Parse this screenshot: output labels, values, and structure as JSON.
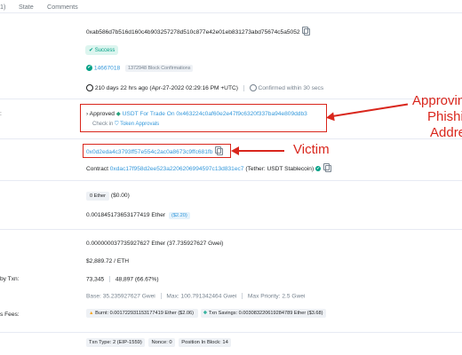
{
  "tabs": {
    "first": "1)",
    "state": "State",
    "comments": "Comments"
  },
  "tx": {
    "hash": "0xab586d7b516d160c4b903257278d510c877e42e01eb831273abd75674c5a5052",
    "status": "Success",
    "block": "14667018",
    "confirmations": "1372948 Block Confirmations",
    "timestamp": "210 days 22 hrs ago (Apr-27-2022 02:29:16 PM +UTC)",
    "confirmed": "Confirmed within 30 secs"
  },
  "action": {
    "row_label": ":",
    "arrow": "›",
    "approved_word": "Approved",
    "token_text": "USDT For Trade On",
    "spender": "0x463224c0af60e2e47f9c6320f337ba94e809ddb3",
    "check_prefix": "Check in",
    "token_approvals": "Token Approvals"
  },
  "from": {
    "address": "0x0d2eda4c3793ff57e554c2ac0a8673c9ffc681fb"
  },
  "to": {
    "prefix": "Contract",
    "address": "0xdac17f958d2ee523a2206206994597c13d831ec7",
    "name": "(Tether: USDT Stablecoin)"
  },
  "value": {
    "ether": "0 Ether",
    "usd": "($0.00)"
  },
  "fee": {
    "amount": "0.001845173653177419 Ether",
    "usd": "($2.20)"
  },
  "gas": {
    "price": "0.000000037735927627 Ether (37.735927627 Gwei)",
    "eth_price": "$2,889.72 / ETH",
    "usage_label": "by Txn:",
    "usage": "73,345",
    "limit": "48,897 (66.67%)",
    "base": "Base: 35.235927627 Gwei",
    "max": "Max: 100.791342464 Gwei",
    "max_priority": "Max Priority: 2.5 Gwei",
    "fees_label": "s Fees:",
    "burnt": "Burnt: 0.001722931153177419 Ether ($2.06)",
    "savings": "Txn Savings: 0.003083220619284789 Ether ($3.68)"
  },
  "other": {
    "type": "Txn Type: 2 (EIP-1559)",
    "nonce": "Nonce: 0",
    "position": "Position In Block: 14"
  },
  "annotations": {
    "approving": "Approving",
    "phishing": "Phishi",
    "address": "Addre",
    "victim": "Victim",
    "color": "#d9261c"
  },
  "colors": {
    "link": "#3498db",
    "success": "#00a186",
    "warning": "#f5a623"
  }
}
